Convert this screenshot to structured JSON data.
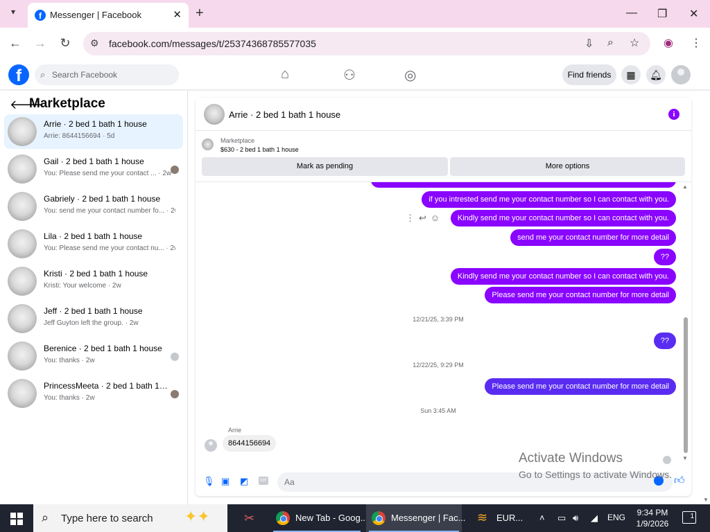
{
  "browser": {
    "tab_title": "Messenger | Facebook",
    "url": "facebook.com/messages/t/25374368785577035"
  },
  "fb": {
    "search_placeholder": "Search Facebook",
    "find_friends": "Find friends"
  },
  "sidebar": {
    "heading": "Marketplace",
    "conversations": [
      {
        "name": "Arrie · 2 bed 1 bath 1 house",
        "snippet": "Arrie: 8644156694 · 5d"
      },
      {
        "name": "Gail · 2 bed 1 bath 1 house",
        "snippet": "You: Please send me your contact ... · 2w"
      },
      {
        "name": "Gabriely · 2 bed 1 bath 1 house",
        "snippet": "You: send me your contact number fo... · 2w"
      },
      {
        "name": "Lila · 2 bed 1 bath 1 house",
        "snippet": "You: Please send me your contact nu... · 2w"
      },
      {
        "name": "Kristi · 2 bed 1 bath 1 house",
        "snippet": "Kristi: Your welcome · 2w"
      },
      {
        "name": "Jeff · 2 bed 1 bath 1 house",
        "snippet": "Jeff Guyton left the group. · 2w"
      },
      {
        "name": "Berenice · 2 bed 1 bath 1 house",
        "snippet": "You: thanks · 2w"
      },
      {
        "name": "PrincessMeeta · 2 bed 1 bath 1 h...",
        "snippet": "You: thanks · 2w"
      }
    ]
  },
  "chat": {
    "title": "Arrie · 2 bed 1 bath 1 house",
    "listing_label": "Marketplace",
    "listing_price": "$630 - 2 bed 1 bath 1 house",
    "mark_pending": "Mark as pending",
    "more_options": "More options",
    "messages": [
      "if you intrested send me your contact number so I can contact with you.",
      "Kindly send me your contact number so I can contact with you.",
      "send me your contact number for more detail",
      "??",
      "Kindly send me your contact number so I can contact with you.",
      "Please send me your contact number for more detail"
    ],
    "timestamp_1": "12/21/25, 3:39 PM",
    "message_after_ts1": "??",
    "timestamp_2": "12/22/25, 9:29 PM",
    "message_after_ts2": "Please send me your contact number for more detail",
    "timestamp_3": "Sun 3:45 AM",
    "incoming_sender": "Arrie",
    "incoming_text": "8644156694",
    "input_placeholder": "Aa",
    "gif_label": "GIF"
  },
  "watermark": {
    "line1": "Activate Windows",
    "line2": "Go to Settings to activate Windows."
  },
  "taskbar": {
    "search_placeholder": "Type here to search",
    "app_new_tab": "New Tab - Goog...",
    "app_messenger": "Messenger | Fac...",
    "currency": "EUR...",
    "language": "ENG",
    "time": "9:34 PM",
    "date": "1/9/2026",
    "notifications": "1"
  }
}
